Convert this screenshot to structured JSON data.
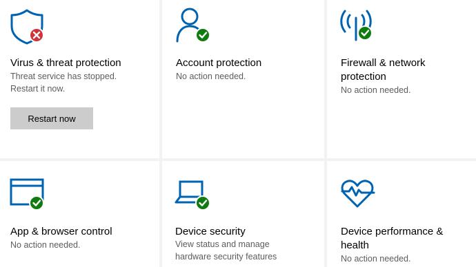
{
  "colors": {
    "icon_blue": "#0063b1",
    "ok_green": "#107c10",
    "error_red": "#d13438",
    "button_bg": "#cccccc",
    "tile_bg": "#ffffff",
    "gap_bg": "#f2f2f2",
    "desc_text": "#5c5c5c"
  },
  "tiles": [
    {
      "title": "Virus & threat protection",
      "description": "Threat service has stopped.\nRestart it now.",
      "icon": "shield-icon",
      "status": "error",
      "status_icon": "error-x-badge-icon",
      "button_label": "Restart now"
    },
    {
      "title": "Account protection",
      "description": "No action needed.",
      "icon": "person-icon",
      "status": "ok",
      "status_icon": "checkmark-badge-icon"
    },
    {
      "title": "Firewall & network\nprotection",
      "description": "No action needed.",
      "icon": "antenna-icon",
      "status": "ok",
      "status_icon": "checkmark-badge-icon"
    },
    {
      "title": "App & browser control",
      "description": "No action needed.",
      "icon": "browser-window-icon",
      "status": "ok",
      "status_icon": "checkmark-badge-icon"
    },
    {
      "title": "Device security",
      "description": "View status and manage\nhardware security features",
      "icon": "laptop-icon",
      "status": "ok",
      "status_icon": "checkmark-badge-icon"
    },
    {
      "title": "Device performance &\nhealth",
      "description": "No action needed.",
      "icon": "heart-pulse-icon",
      "status": "ok",
      "status_icon": "checkmark-badge-icon"
    }
  ]
}
